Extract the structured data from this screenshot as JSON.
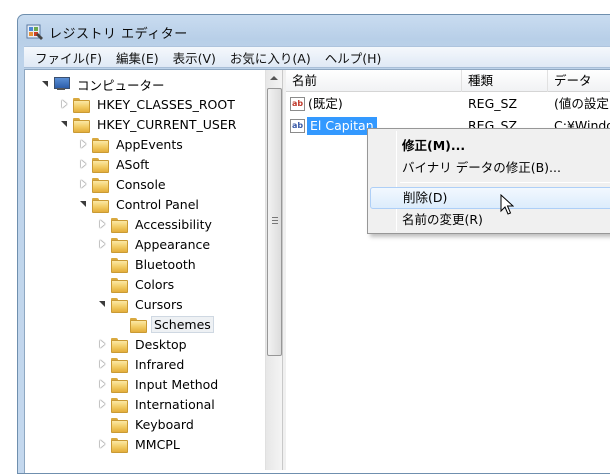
{
  "window": {
    "title": "レジストリ エディター"
  },
  "menubar": [
    "ファイル(F)",
    "編集(E)",
    "表示(V)",
    "お気に入り(A)",
    "ヘルプ(H)"
  ],
  "tree": {
    "root_label": "コンピューター",
    "items": [
      {
        "label": "HKEY_CLASSES_ROOT",
        "expander": "closed"
      },
      {
        "label": "HKEY_CURRENT_USER",
        "expander": "open"
      },
      {
        "label": "AppEvents",
        "expander": "closed"
      },
      {
        "label": "ASoft",
        "expander": "closed"
      },
      {
        "label": "Console",
        "expander": "closed"
      },
      {
        "label": "Control Panel",
        "expander": "open"
      },
      {
        "label": "Accessibility",
        "expander": "closed"
      },
      {
        "label": "Appearance",
        "expander": "closed"
      },
      {
        "label": "Bluetooth",
        "expander": "none"
      },
      {
        "label": "Colors",
        "expander": "none"
      },
      {
        "label": "Cursors",
        "expander": "open"
      },
      {
        "label": "Schemes",
        "expander": "none",
        "selected": true
      },
      {
        "label": "Desktop",
        "expander": "closed"
      },
      {
        "label": "Infrared",
        "expander": "closed"
      },
      {
        "label": "Input Method",
        "expander": "closed"
      },
      {
        "label": "International",
        "expander": "closed"
      },
      {
        "label": "Keyboard",
        "expander": "none"
      },
      {
        "label": "MMCPL",
        "expander": "closed"
      }
    ]
  },
  "list": {
    "columns": [
      "名前",
      "種類",
      "データ"
    ],
    "rows": [
      {
        "name": "(既定)",
        "type": "REG_SZ",
        "data": "(値の設定な",
        "icon": "string-value-icon"
      },
      {
        "name": "El Capitan",
        "type": "REG_SZ",
        "data": "C:¥Window",
        "icon": "string-value-icon",
        "editing": true
      }
    ]
  },
  "context_menu": {
    "items": [
      {
        "label": "修正(M)...",
        "bold": true
      },
      {
        "label": "バイナリ データの修正(B)..."
      },
      {
        "label": "削除(D)",
        "hover": true
      },
      {
        "label": "名前の変更(R)"
      }
    ]
  },
  "colors": {
    "selection": "#3399ff",
    "folder": "#f0c85c",
    "titlebar": "#c9dcf0"
  }
}
